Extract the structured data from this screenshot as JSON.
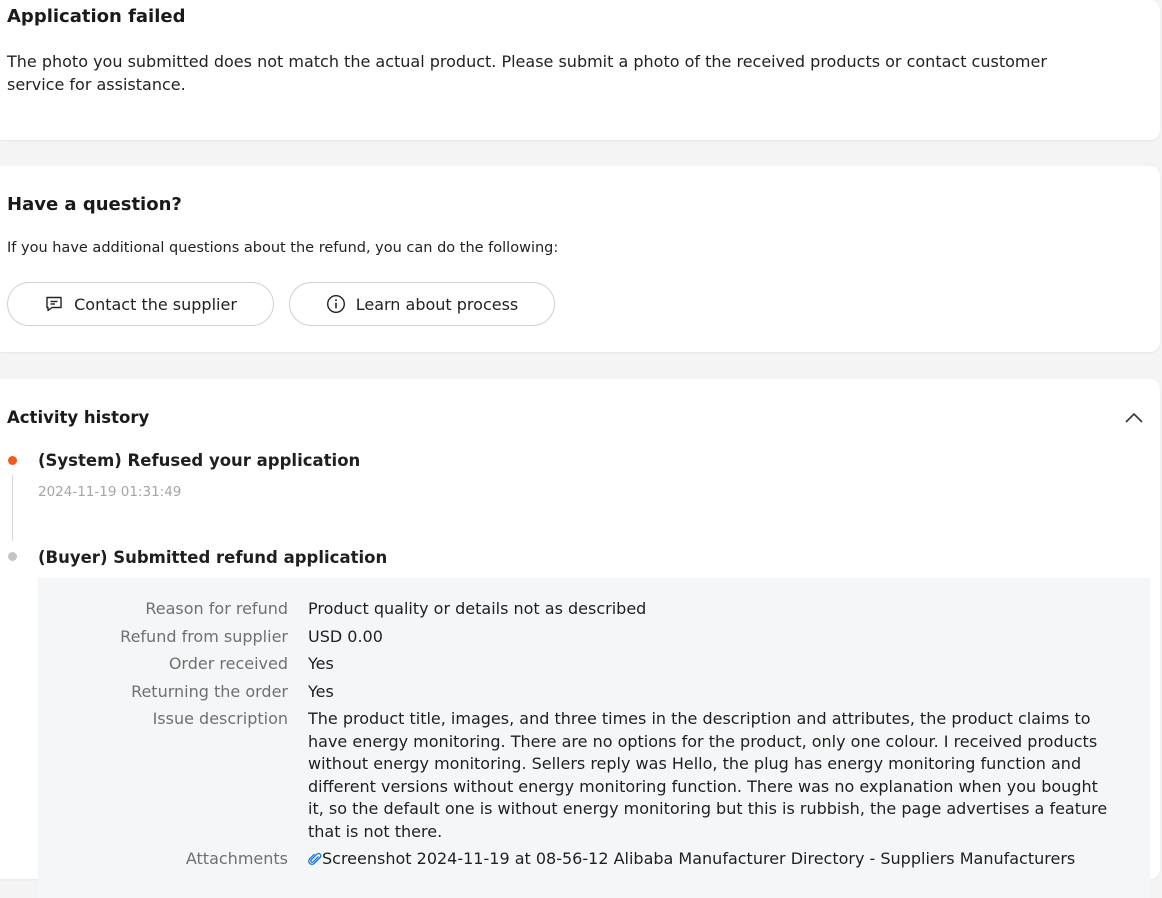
{
  "failed": {
    "title": "Application failed",
    "description": "The photo you submitted does not match the actual product. Please submit a photo of the received products or contact customer service for assistance."
  },
  "question": {
    "title": "Have a question?",
    "description": "If you have additional questions about the refund, you can do the following:",
    "contact_label": "Contact the supplier",
    "learn_label": "Learn about process"
  },
  "activity": {
    "title": "Activity history",
    "events": [
      {
        "title": "(System) Refused your application",
        "time": "2024-11-19 01:31:49",
        "dot_color": "#f05a1a"
      },
      {
        "title": "(Buyer) Submitted refund application",
        "dot_color": "#c4c4c4",
        "details": {
          "reason_label": "Reason for refund",
          "reason_value": "Product quality or details not as described",
          "refund_label": "Refund from supplier",
          "refund_value": "USD 0.00",
          "received_label": "Order received",
          "received_value": "Yes",
          "returning_label": "Returning the order",
          "returning_value": "Yes",
          "issue_label": "Issue description",
          "issue_value": "The product title, images, and three times in the description and attributes, the product claims to have energy monitoring. There are no options for the product, only one colour. I received products without energy monitoring. Sellers reply was Hello, the plug has energy monitoring function and different versions without energy monitoring function. There was no explanation when you bought it, so the default one is without energy monitoring but this is rubbish, the page advertises a feature that is not there.",
          "attachments_label": "Attachments",
          "attachment_name": "Screenshot 2024-11-19 at 08-56-12 Alibaba Manufacturer Directory - Suppliers Manufacturers"
        }
      }
    ]
  },
  "colors": {
    "accent_orange": "#f05a1a",
    "link_blue": "#1a73d9"
  },
  "icons": [
    "chat-icon",
    "info-icon",
    "chevron-up-icon",
    "paperclip-icon"
  ]
}
